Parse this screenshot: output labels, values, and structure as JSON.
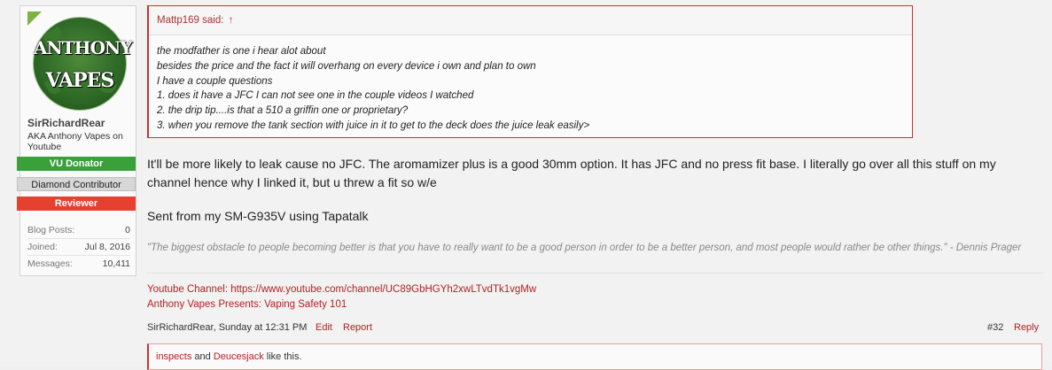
{
  "user": {
    "avatar_logo_top": "ANTHONY",
    "avatar_logo_bottom": "VAPES",
    "name": "SirRichardRear",
    "title": "AKA Anthony Vapes on Youtube",
    "banners": [
      "VU Donator",
      "Diamond Contributor",
      "Reviewer"
    ],
    "stats": [
      {
        "label": "Blog Posts:",
        "value": "0"
      },
      {
        "label": "Joined:",
        "value": "Jul 8, 2016"
      },
      {
        "label": "Messages:",
        "value": "10,411"
      }
    ]
  },
  "quote": {
    "author_label": "Mattp169 said:",
    "arrow": "↑",
    "lines": [
      "the modfather is one i hear alot about",
      "besides the price and the fact it will overhang on every device i own and plan to own",
      "I have a couple questions",
      "1. does it have a JFC I can not see one in the couple videos I watched",
      "2. the drip tip....is that a 510 a griffin one or proprietary?",
      "3. when you remove the tank section with juice in it to get to the deck does the juice leak easily>"
    ]
  },
  "message": {
    "text": "It'll be more likely to leak cause no JFC. The aromamizer plus is a good 30mm option. It has JFC and no press fit base. I literally go over all this stuff on my channel hence why I linked it, but u threw a fit so w/e",
    "sent_from": "Sent from my SM-G935V using Tapatalk"
  },
  "signature": {
    "quote": "\"The biggest obstacle to people becoming better is that you have to really want to be a good person in order to be a better person, and most people would rather be other things.\" - Dennis Prager",
    "link1": "Youtube Channel: https://www.youtube.com/channel/UC89GbHGYh2xwLTvdTk1vgMw",
    "link2": "Anthony Vapes Presents: Vaping Safety 101"
  },
  "footer": {
    "author_time": "SirRichardRear, Sunday at 12:31 PM",
    "edit": "Edit",
    "report": "Report",
    "post_number": "#32",
    "reply": "Reply"
  },
  "likes": {
    "user1": "inspects",
    "and": "and",
    "user2": "Deucesjack",
    "suffix": "like this."
  },
  "colors": {
    "link": "#b22222",
    "donator": "#3aa13a",
    "reviewer": "#e64030",
    "diamond": "#d7d7d7"
  }
}
